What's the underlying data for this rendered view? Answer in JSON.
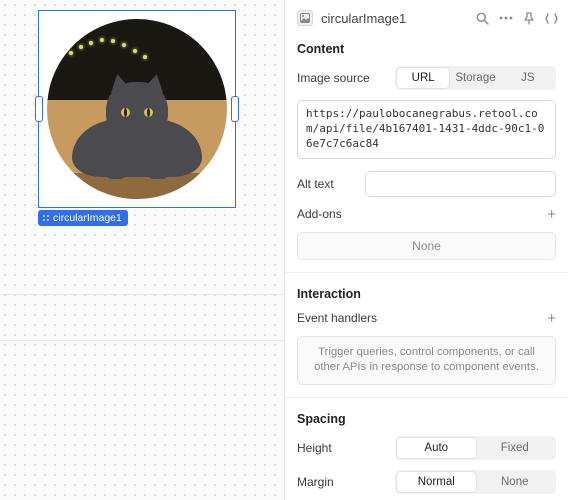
{
  "canvas": {
    "selected_component_label": "circularImage1"
  },
  "panel": {
    "component_name": "circularImage1",
    "sections": {
      "content": {
        "title": "Content",
        "image_source_label": "Image source",
        "source_tabs": {
          "url": "URL",
          "storage": "Storage",
          "js": "JS",
          "active": "url"
        },
        "url_value": "https://paulobocanegrabus.retool.com/api/file/4b167401-1431-4ddc-90c1-06e7c7c6ac84",
        "alt_text_label": "Alt text",
        "alt_text_value": "",
        "addons_label": "Add-ons",
        "addons_empty": "None"
      },
      "interaction": {
        "title": "Interaction",
        "event_handlers_label": "Event handlers",
        "event_hint": "Trigger queries, control components, or call other APIs in response to component events."
      },
      "spacing": {
        "title": "Spacing",
        "height_label": "Height",
        "height_tabs": {
          "auto": "Auto",
          "fixed": "Fixed",
          "active": "auto"
        },
        "margin_label": "Margin",
        "margin_tabs": {
          "normal": "Normal",
          "none": "None",
          "active": "normal"
        }
      }
    }
  }
}
